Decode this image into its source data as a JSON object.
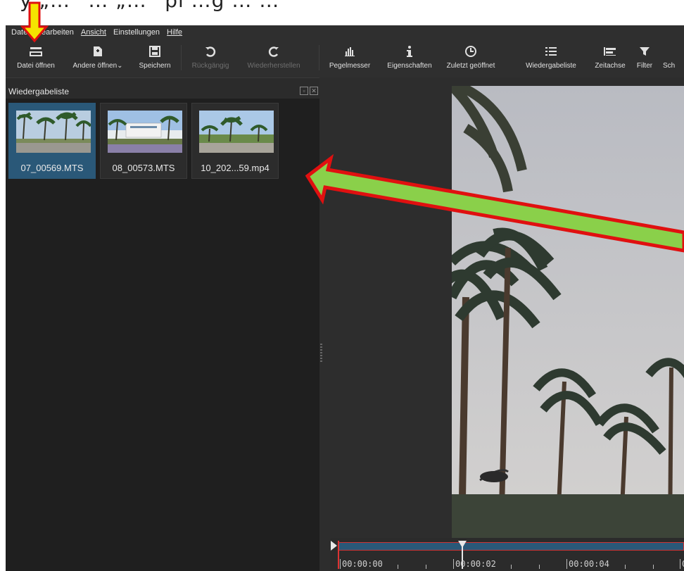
{
  "caption": {
    "text": "y „…“ … „…“ pl …g … …"
  },
  "menu": [
    {
      "label": "Datei"
    },
    {
      "label": "Bearbeiten"
    },
    {
      "label": "Ansicht"
    },
    {
      "label": "Einstellungen"
    },
    {
      "label": "Hilfe"
    }
  ],
  "toolbar": [
    {
      "label": "Datei öffnen",
      "icon": "open-file-icon",
      "enabled": true
    },
    {
      "label": "Andere öffnen⌄",
      "icon": "open-other-icon",
      "enabled": true
    },
    {
      "label": "Speichern",
      "icon": "save-icon",
      "enabled": true
    },
    {
      "label": "Rückgängig",
      "icon": "undo-icon",
      "enabled": false
    },
    {
      "label": "Wiederherstellen",
      "icon": "redo-icon",
      "enabled": false
    },
    {
      "label": "Pegelmesser",
      "icon": "level-meter-icon",
      "enabled": true
    },
    {
      "label": "Eigenschaften",
      "icon": "info-icon",
      "enabled": true
    },
    {
      "label": "Zuletzt geöffnet",
      "icon": "clock-icon",
      "enabled": true
    },
    {
      "label": "Wiedergabeliste",
      "icon": "list-icon",
      "enabled": true
    },
    {
      "label": "Zeitachse",
      "icon": "timeline-icon",
      "enabled": true
    },
    {
      "label": "Filter",
      "icon": "filter-icon",
      "enabled": true
    },
    {
      "label": "Sch",
      "icon": "",
      "enabled": true
    }
  ],
  "playlist": {
    "title": "Wiedergabeliste",
    "items": [
      {
        "label": "07_00569.MTS",
        "selected": true
      },
      {
        "label": "08_00573.MTS",
        "selected": false
      },
      {
        "label": "10_202...59.mp4",
        "selected": false
      }
    ]
  },
  "timeline": {
    "labels": [
      "00:00:00",
      "00:00:02",
      "00:00:04",
      "0"
    ]
  },
  "colors": {
    "accent": "#2a5878",
    "annotation_arrow_fill": "#8ad04a",
    "annotation_arrow_border": "#e01010",
    "annotation_down_arrow": "#f5e400"
  }
}
